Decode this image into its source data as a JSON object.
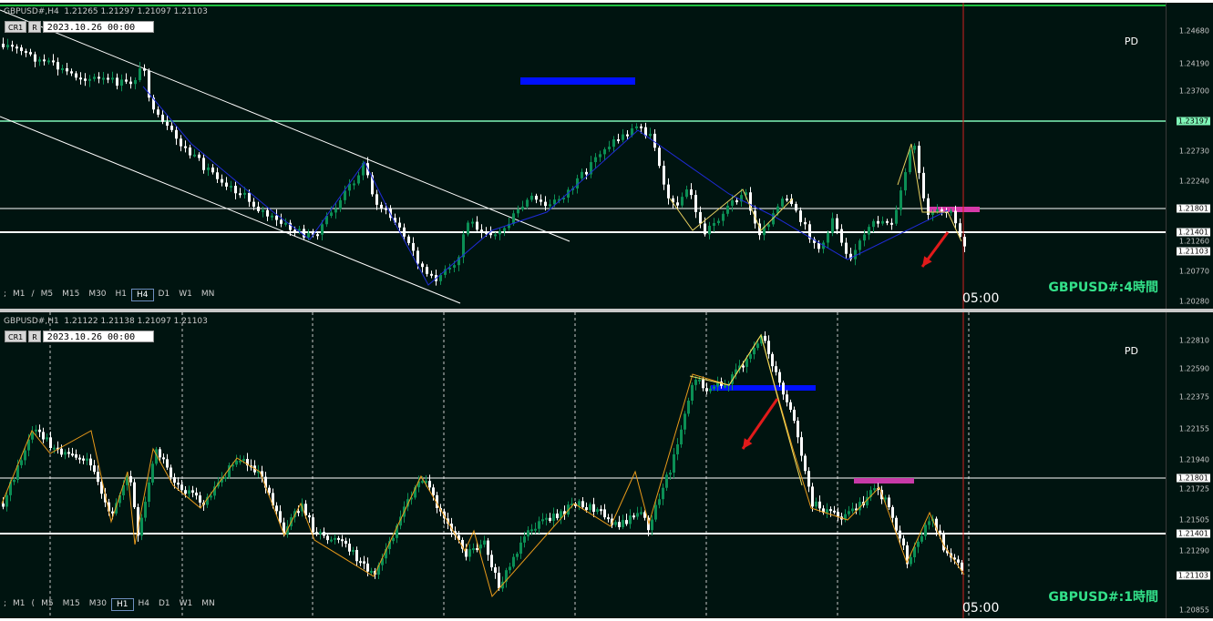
{
  "panels": [
    {
      "id": "h4",
      "title": "GBPUSD#,H4  1.21265 1.21297 1.21097 1.21103",
      "controls": {
        "cr1": "CR1",
        "r": "R",
        "date": "2023.10.26 00:00"
      },
      "pd": "PD",
      "symbol_label": "GBPUSD#:4時間",
      "time_label": "05:00",
      "timeframes": [
        ";",
        "M1",
        "/",
        "M5",
        "M15",
        "M30",
        "H1",
        "H4",
        "D1",
        "W1",
        "MN"
      ],
      "active_tf": "H4",
      "ticks": [
        "1.24680",
        "1.24190",
        "1.23700",
        "1.23197",
        "1.22730",
        "1.22240",
        "1.21801",
        "1.21401",
        "1.21260",
        "1.21103",
        "1.20770",
        "1.20280"
      ],
      "tick_tags": {
        "1.23197": "green",
        "1.21801": "white",
        "1.21401": "white",
        "1.21103": "white"
      },
      "colors": {
        "background": "#001410",
        "up": "#0b8f55",
        "down": "#ffffff",
        "zigzag": "#1f2bd6",
        "channel": "#ffffff",
        "support": "#ffffff",
        "resistance": "#7ff5b7",
        "blue_zone": "#0010ff",
        "magenta_zone": "#d63aa8",
        "arrow": "#e11a1a",
        "cursor": "#d02020"
      }
    },
    {
      "id": "h1",
      "title": "GBPUSD#,H1  1.21122 1.21138 1.21097 1.21103",
      "controls": {
        "cr1": "CR1",
        "r": "R",
        "date": "2023.10.26 00:00"
      },
      "pd": "PD",
      "symbol_label": "GBPUSD#:1時間",
      "time_label": "05:00",
      "timeframes": [
        ";",
        "M1",
        "(",
        "M5",
        "M15",
        "M30",
        "H1",
        "H4",
        "D1",
        "W1",
        "MN"
      ],
      "active_tf": "H1",
      "ticks": [
        "1.22810",
        "1.22590",
        "1.22375",
        "1.22155",
        "1.21940",
        "1.21801",
        "1.21725",
        "1.21505",
        "1.21401",
        "1.21290",
        "1.21103",
        "1.20855"
      ],
      "tick_tags": {
        "1.21801": "white",
        "1.21401": "white",
        "1.21103": "white"
      },
      "colors": {
        "background": "#001410",
        "up": "#0b8f55",
        "down": "#ffffff",
        "zigzag": "#e89a1a",
        "support": "#ffffff",
        "blue_zone": "#0010ff",
        "magenta_zone": "#c83aa8",
        "arrow": "#e11a1a",
        "cursor": "#d02020",
        "session": "#c8c8c8"
      }
    }
  ]
}
